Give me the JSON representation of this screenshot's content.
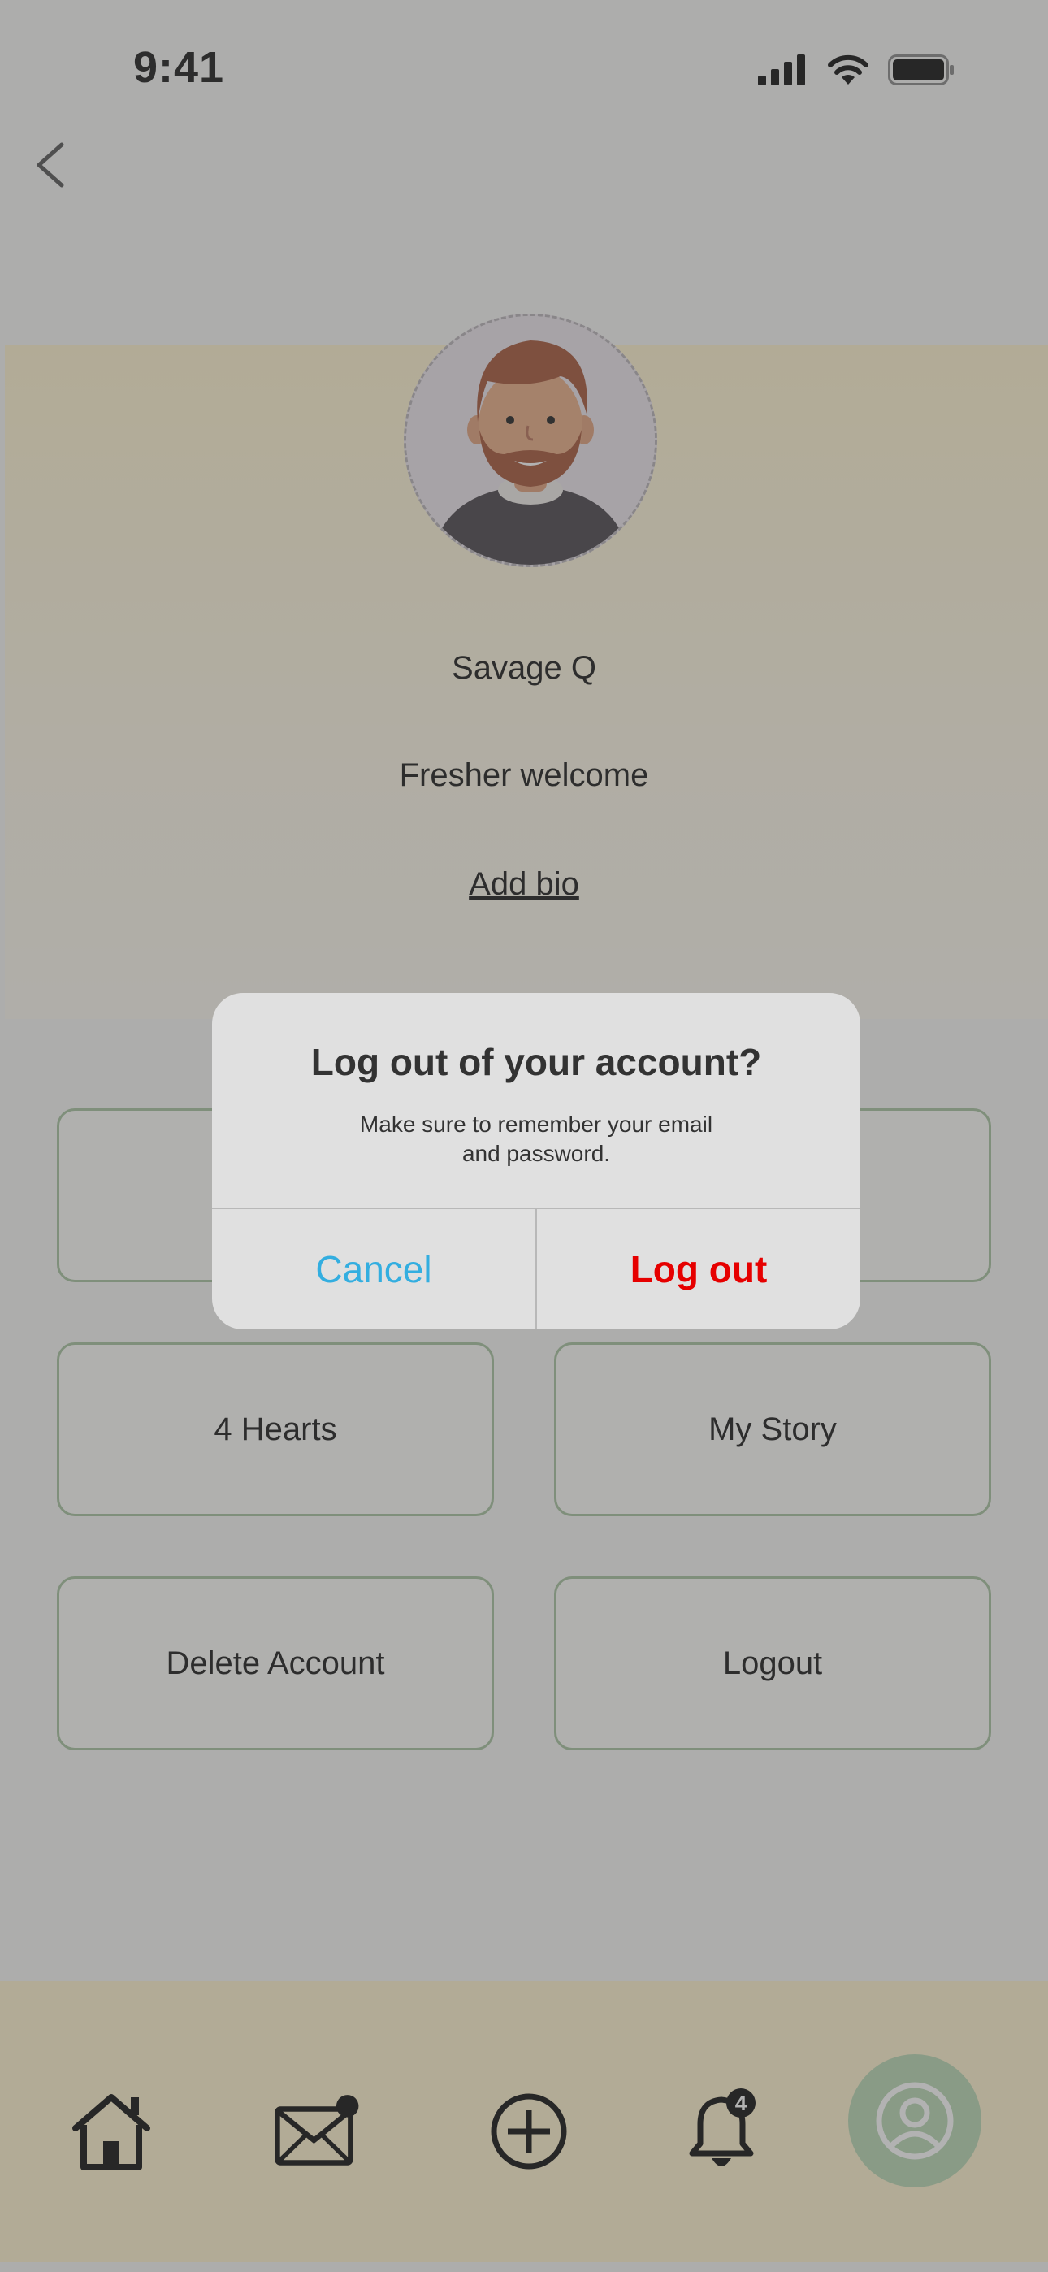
{
  "status_bar": {
    "time": "9:41"
  },
  "profile": {
    "name": "Savage Q",
    "subtitle": "Fresher welcome",
    "add_bio": "Add bio"
  },
  "grid": {
    "hearts": "4 Hearts",
    "my_story": "My Story",
    "delete_account": "Delete Account",
    "logout": "Logout"
  },
  "nav": {
    "items": [
      "home-icon",
      "mail-icon",
      "add-icon",
      "bell-icon",
      "profile-icon"
    ],
    "notification_count": "4",
    "active": "profile"
  },
  "dialog": {
    "title": "Log out of your account?",
    "message": "Make sure to remember your email and password.",
    "cancel": "Cancel",
    "confirm": "Log out"
  },
  "colors": {
    "accent_green": "#a8c3a0",
    "band_yellow": "#fff3cf",
    "cancel_blue": "#33aee0",
    "logout_red": "#e60000"
  }
}
